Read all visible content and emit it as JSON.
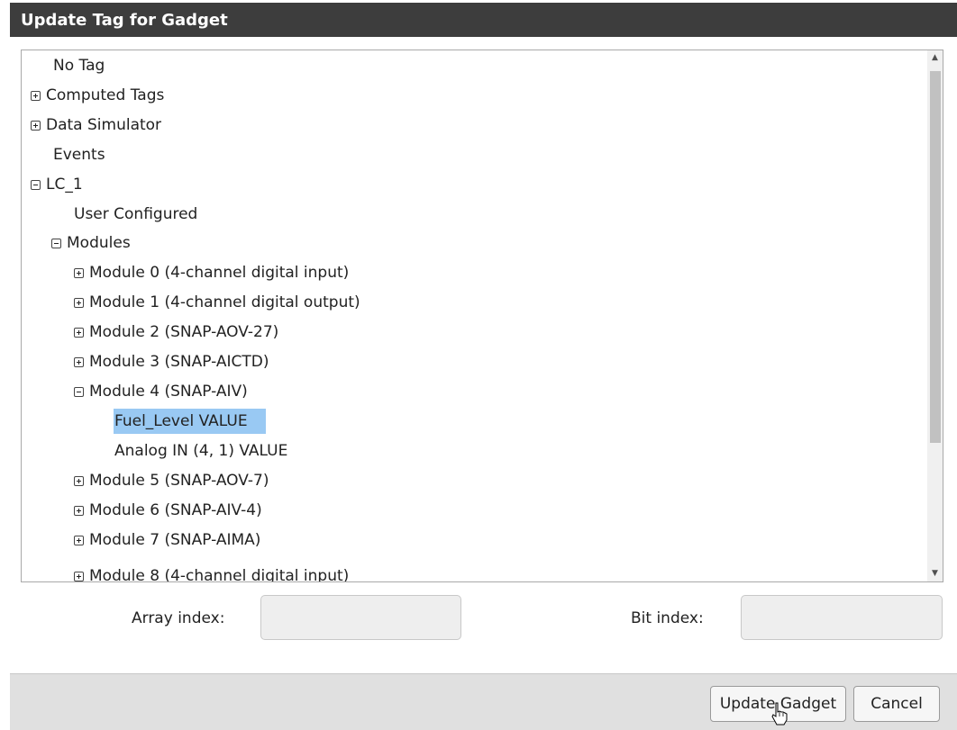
{
  "dialog": {
    "title": "Update Tag for Gadget"
  },
  "tree": {
    "nodes": [
      {
        "label": "No Tag",
        "toggle": "none"
      },
      {
        "label": "Computed Tags",
        "toggle": "plus"
      },
      {
        "label": "Data Simulator",
        "toggle": "plus"
      },
      {
        "label": "Events",
        "toggle": "none"
      },
      {
        "label": "LC_1",
        "toggle": "minus"
      },
      {
        "label": "User Configured",
        "toggle": "none"
      },
      {
        "label": "Modules",
        "toggle": "minus"
      },
      {
        "label": "Module 0 (4-channel digital input)",
        "toggle": "plus"
      },
      {
        "label": "Module 1 (4-channel digital output)",
        "toggle": "plus"
      },
      {
        "label": "Module 2 (SNAP-AOV-27)",
        "toggle": "plus"
      },
      {
        "label": "Module 3 (SNAP-AICTD)",
        "toggle": "plus"
      },
      {
        "label": "Module 4 (SNAP-AIV)",
        "toggle": "minus"
      },
      {
        "label": "Fuel_Level VALUE",
        "toggle": "none",
        "selected": true
      },
      {
        "label": "Analog IN (4, 1) VALUE",
        "toggle": "none"
      },
      {
        "label": "Module 5 (SNAP-AOV-7)",
        "toggle": "plus"
      },
      {
        "label": "Module 6 (SNAP-AIV-4)",
        "toggle": "plus"
      },
      {
        "label": "Module 7 (SNAP-AIMA)",
        "toggle": "plus"
      },
      {
        "label": "Module 8 (4-channel digital input)",
        "toggle": "plus"
      }
    ]
  },
  "fields": {
    "array_index_label": "Array index:",
    "array_index_value": "",
    "bit_index_label": "Bit index:",
    "bit_index_value": ""
  },
  "buttons": {
    "update": "Update Gadget",
    "cancel": "Cancel"
  },
  "icons": {
    "scroll_up": "chevron-up-icon",
    "scroll_down": "chevron-down-icon",
    "cursor": "hand-pointer-icon"
  },
  "colors": {
    "titlebar": "#3d3d3d",
    "selection": "#99c9f3",
    "footer": "#e0e0e0"
  }
}
